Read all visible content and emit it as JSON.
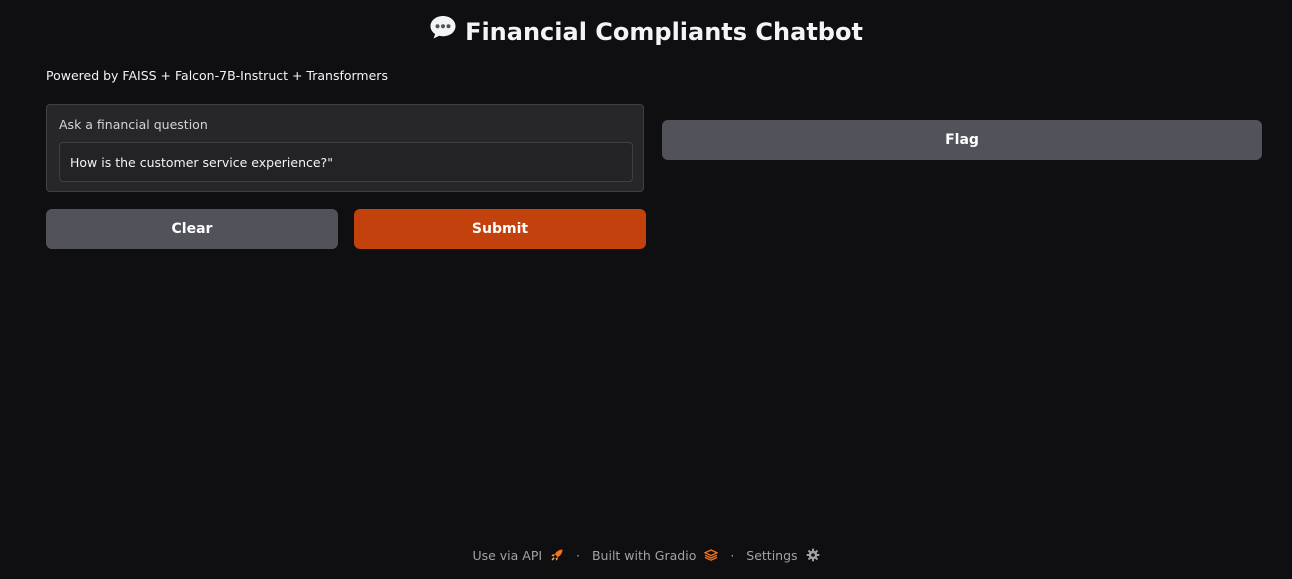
{
  "header": {
    "title": "Financial Compliants Chatbot",
    "icon": "speech-bubble-icon",
    "subtitle": "Powered by FAISS + Falcon-7B-Instruct + Transformers"
  },
  "question": {
    "label": "Ask a financial question",
    "value": "How is the customer service experience?\""
  },
  "buttons": {
    "clear": "Clear",
    "submit": "Submit",
    "flag": "Flag"
  },
  "footer": {
    "api_link": "Use via API",
    "api_icon": "rocket-icon",
    "separator": "·",
    "built_with": "Built with Gradio",
    "gradio_icon": "gradio-logo-icon",
    "settings": "Settings",
    "settings_icon": "gear-icon"
  },
  "colors": {
    "background": "#0f0f11",
    "panel": "#27272a",
    "secondary_button": "#52525b",
    "primary_button": "#c2410c",
    "accent": "#f97316"
  }
}
